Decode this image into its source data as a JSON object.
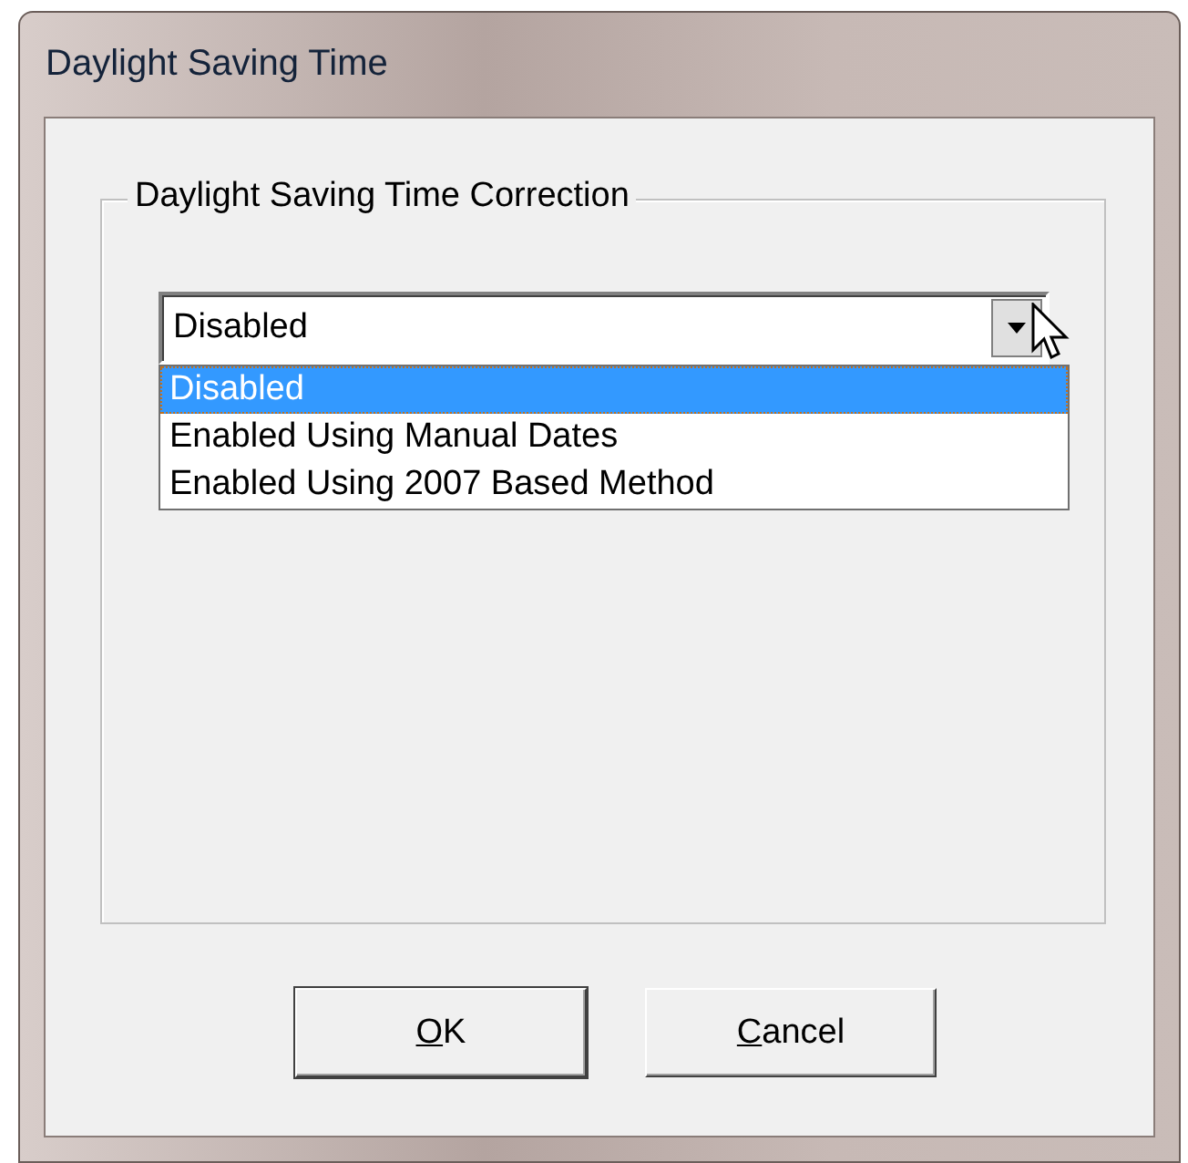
{
  "window": {
    "title": "Daylight Saving Time"
  },
  "group": {
    "label": "Daylight Saving Time Correction"
  },
  "combo": {
    "value": "Disabled",
    "expanded": true,
    "options": [
      {
        "label": "Disabled",
        "selected": true
      },
      {
        "label": "Enabled Using Manual Dates",
        "selected": false
      },
      {
        "label": "Enabled Using 2007 Based Method",
        "selected": false
      }
    ]
  },
  "buttons": [
    {
      "mnemonic": "O",
      "rest": "K",
      "default": true
    },
    {
      "mnemonic": "C",
      "rest": "ancel",
      "default": false
    }
  ]
}
